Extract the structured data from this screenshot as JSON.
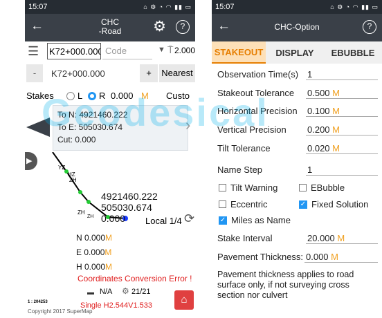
{
  "left": {
    "status_time": "15:07",
    "title_line1": "CHC",
    "title_line2": "-Road",
    "station_value": "K72+000.000",
    "code_placeholder": "Code",
    "height_value": "2.000",
    "minus_label": "-",
    "station_value2": "K72+000.000",
    "plus_label": "+",
    "nearest_label": "Nearest",
    "stakes_label": "Stakes",
    "radio_l": "L",
    "radio_r": "R",
    "offset_value": "0.000",
    "offset_unit": "M",
    "custom_label": "Custo",
    "to_n": "To N: 4921460.222",
    "to_e": "To E: 505030.674",
    "cut": "Cut: 0.000",
    "pt_yz": "YZ",
    "pt_hz": "HZ",
    "pt_zh": "ZH",
    "pt_zh2": "ZH",
    "pt_zh3": "ZH",
    "map_n": "4921460.222",
    "map_e": "505030.674",
    "map_h": "0.000",
    "local_label": "Local 1/4",
    "n_label": "N 0.000",
    "e_label": "E 0.000",
    "h_label": "H 0.000",
    "unit_m": "M",
    "error_text": "Coordinates Conversion Error !",
    "na_text": "N/A",
    "sat_text": "21/21",
    "scale_text": "1 : 204253",
    "solution_text": "Single H2.544V1.533",
    "copyright": "Copyright 2017 SuperMap"
  },
  "right": {
    "status_time": "15:07",
    "title": "CHC-Option",
    "tabs": [
      "STAKEOUT",
      "DISPLAY",
      "EBUBBLE"
    ],
    "observation_label": "Observation Time(s)",
    "observation_value": "1",
    "stakeout_tol_label": "Stakeout Tolerance",
    "stakeout_tol_value": "0.500",
    "hprec_label": "Horizontal Precision",
    "hprec_value": "0.100",
    "vprec_label": "Vertical Precision",
    "vprec_value": "0.200",
    "tilt_tol_label": "Tilt Tolerance",
    "tilt_tol_value": "0.020",
    "name_step_label": "Name Step",
    "name_step_value": "1",
    "tilt_warning": "Tilt Warning",
    "ebubble": "EBubble",
    "eccentric": "Eccentric",
    "fixed_solution": "Fixed Solution",
    "miles_as_name": "Miles as Name",
    "stake_interval_label": "Stake Interval",
    "stake_interval_value": "20.000",
    "pavement_label": "Pavement Thickness:",
    "pavement_value": "0.000",
    "unit_m": "M",
    "note": "Pavement thickness applies to road surface only, if not surveying cross section nor culvert"
  },
  "watermark": "Geodesical",
  "colors": {
    "accent": "#e67e00",
    "unit": "#f0a020",
    "error": "#e02020",
    "check": "#2196f3"
  }
}
